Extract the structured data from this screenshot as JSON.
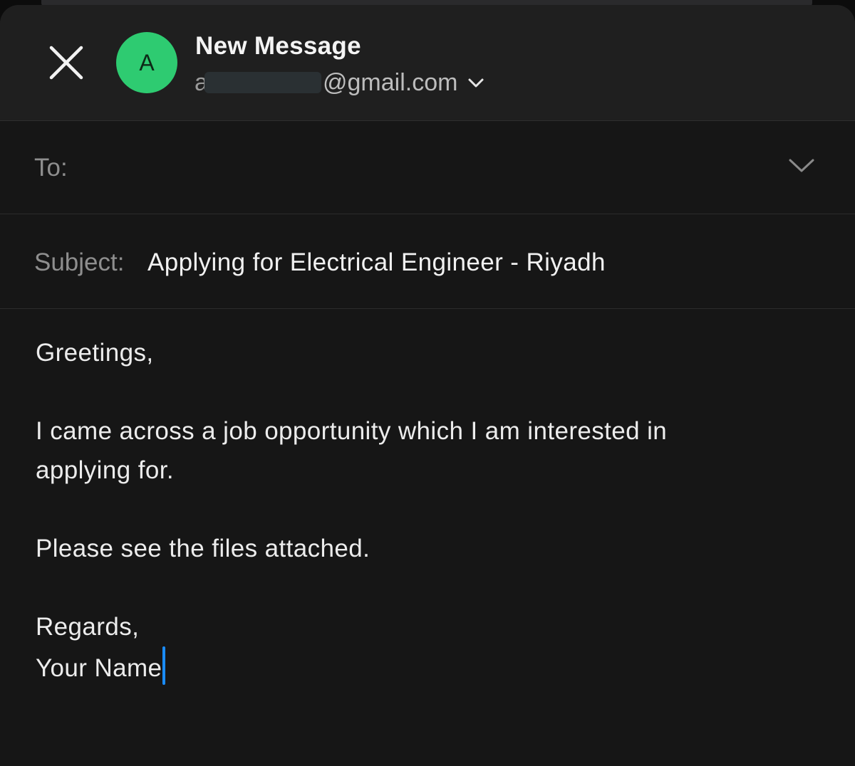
{
  "compose": {
    "title": "New Message",
    "avatar_letter": "A",
    "from_prefix": "a",
    "from_domain": "@gmail.com",
    "to_label": "To:",
    "to_value": "",
    "subject_label": "Subject:",
    "subject_value": "Applying for Electrical Engineer - Riyadh",
    "accent_color": "#2ecb71",
    "caret_color": "#1a8cff"
  },
  "body": {
    "greeting": "Greetings,",
    "paragraph1": "I came across a job opportunity which I am interested in applying for.",
    "paragraph2": "Please see the files attached.",
    "closing": "Regards,",
    "signature": "Your Name"
  },
  "icons": {
    "close": "close-icon",
    "from_dropdown": "chevron-down-icon",
    "to_expand": "chevron-down-icon"
  }
}
